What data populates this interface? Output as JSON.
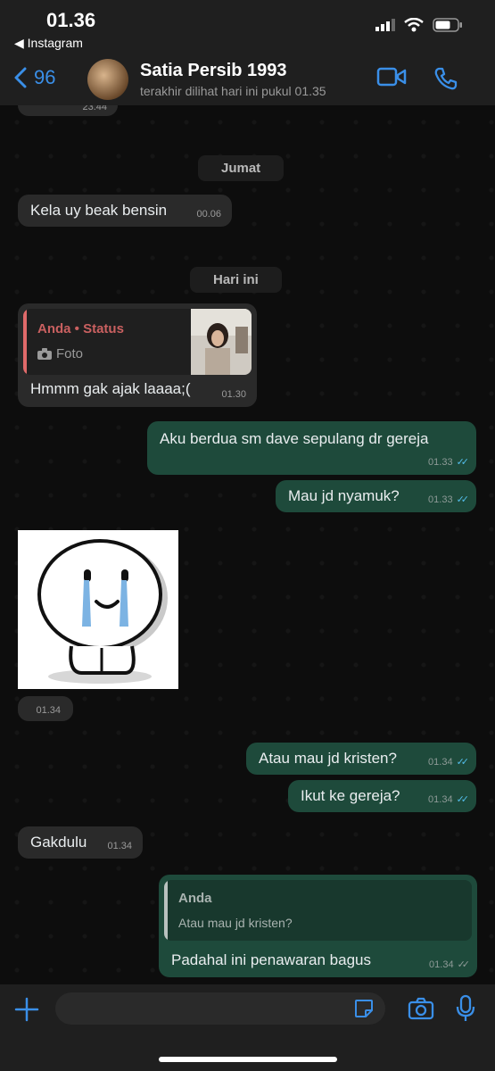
{
  "status_bar": {
    "time": "01.36",
    "back_app": "◀ Instagram"
  },
  "header": {
    "back_count": "96",
    "contact_name": "Satia Persib 1993",
    "last_seen": "terakhir dilihat hari ini pukul 01.35"
  },
  "chat": {
    "partial_time": "23.44",
    "date_1": "Jumat",
    "msg1": {
      "text": "Kela uy beak bensin",
      "time": "00.06"
    },
    "date_2": "Hari ini",
    "msg2": {
      "quote_author": "Anda • Status",
      "quote_type": "Foto",
      "text": "Hmmm gak ajak laaaa;(",
      "time": "01.30"
    },
    "msg3": {
      "text": "Aku berdua sm dave sepulang dr gereja",
      "time": "01.33",
      "ticks": "✓✓"
    },
    "msg4": {
      "text": "Mau jd nyamuk?",
      "time": "01.33",
      "ticks": "✓✓"
    },
    "sticker": {
      "time": "01.34"
    },
    "msg5": {
      "text": "Atau mau jd kristen?",
      "time": "01.34",
      "ticks": "✓✓"
    },
    "msg6": {
      "text": "Ikut ke gereja?",
      "time": "01.34",
      "ticks": "✓✓"
    },
    "msg7": {
      "text": "Gakdulu",
      "time": "01.34"
    },
    "msg8": {
      "quote_author": "Anda",
      "quote_text": "Atau mau jd kristen?",
      "text": "Padahal ini penawaran bagus",
      "time": "01.34",
      "ticks": "✓✓"
    }
  },
  "colors": {
    "accent": "#3a8fe8",
    "outgoing": "#1e4a3b",
    "incoming": "#2a2a2a",
    "status_quote": "#e06a6a",
    "read_tick": "#53bdeb"
  }
}
